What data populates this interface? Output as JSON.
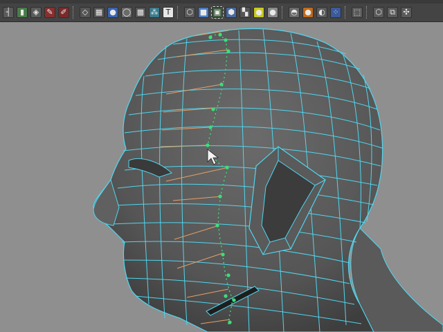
{
  "toolbar": {
    "tools": [
      {
        "name": "curve-tool-icon",
        "glyph": "┤",
        "bg": "#5a5a5a"
      },
      {
        "name": "bar-tool-icon",
        "glyph": "▮",
        "bg": "#4a7c4a"
      },
      {
        "name": "plane-tool-icon",
        "glyph": "◈",
        "bg": "#5a5a5a"
      },
      {
        "name": "paint-tool-icon",
        "glyph": "✎",
        "bg": "#8b2e2e"
      },
      {
        "name": "brush-tool-icon",
        "glyph": "✐",
        "bg": "#7a2a2a"
      },
      {
        "sep": true
      },
      {
        "name": "layers-icon",
        "glyph": "◇",
        "bg": "#555555"
      },
      {
        "name": "grid-icon",
        "glyph": "▦",
        "bg": "#555555"
      },
      {
        "name": "sphere-shader-icon",
        "glyph": "●",
        "bg": "#3a64b0"
      },
      {
        "name": "flat-shader-icon",
        "glyph": "◯",
        "bg": "#6a6a6a"
      },
      {
        "name": "checker-icon",
        "glyph": "▩",
        "bg": "#555555"
      },
      {
        "name": "cluster-icon",
        "glyph": "⁂",
        "bg": "#3a7a8a"
      },
      {
        "name": "text-tool-icon",
        "glyph": "T",
        "bg": "#e6e6e6"
      },
      {
        "sep": true
      },
      {
        "name": "wireframe-cube-icon",
        "glyph": "⬡",
        "bg": "#5a5a5a"
      },
      {
        "name": "shaded-cube-icon",
        "glyph": "■",
        "bg": "#4a7ac0"
      },
      {
        "name": "wireframe-on-shaded-icon",
        "glyph": "▣",
        "bg": "#3a5a3a",
        "active": true
      },
      {
        "name": "textured-cube-icon",
        "glyph": "⬢",
        "bg": "#4a6aa0"
      },
      {
        "name": "checker-texture-icon",
        "glyph": "▚",
        "bg": "#555555"
      },
      {
        "name": "light-sphere-icon",
        "glyph": "●",
        "bg": "#c8c820"
      },
      {
        "name": "gray-sphere-icon",
        "glyph": "●",
        "bg": "#8a8a8a"
      },
      {
        "sep": true
      },
      {
        "name": "spotlight-icon",
        "glyph": "◓",
        "bg": "#6a6a6a"
      },
      {
        "name": "orange-light-icon",
        "glyph": "●",
        "bg": "#c06a1a"
      },
      {
        "name": "shadow-icon",
        "glyph": "◐",
        "bg": "#5a5a5a"
      },
      {
        "name": "multi-spheres-icon",
        "glyph": "⁘",
        "bg": "#3a5a9a"
      },
      {
        "sep": true
      },
      {
        "name": "selection-icon",
        "glyph": "⬚",
        "bg": "#5a5a5a"
      },
      {
        "sep": true
      },
      {
        "name": "isolate-cube-icon",
        "glyph": "⬡",
        "bg": "#5a5a5a"
      },
      {
        "name": "two-panels-icon",
        "glyph": "⧉",
        "bg": "#5a5a5a"
      },
      {
        "name": "node-graph-icon",
        "glyph": "✣",
        "bg": "#5a5a5a"
      }
    ]
  },
  "colors": {
    "viewport_bg": "#8f8f8f",
    "mesh_fill": "#5c5c5c",
    "wire": "#4fd7f0",
    "edge_loop": "#e8a066",
    "selected_vertex": "#3ae07a"
  }
}
